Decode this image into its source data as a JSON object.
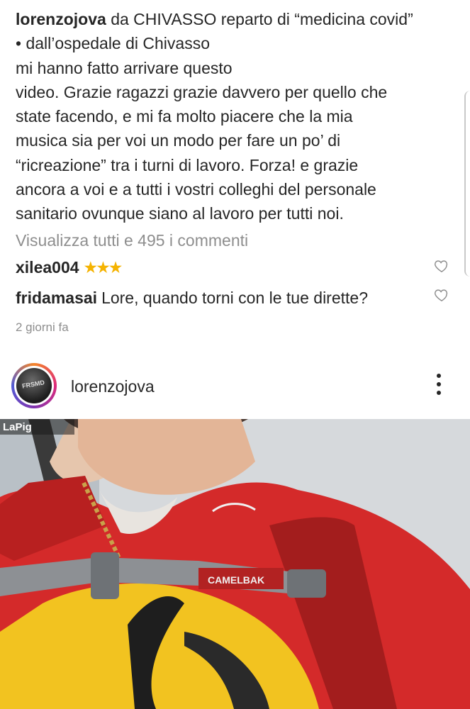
{
  "caption": {
    "username": "lorenzojova",
    "text": " da CHIVASSO reparto di “medicina covid”\n• dall’ospedale di Chivasso\nmi hanno fatto arrivare questo\nvideo. Grazie ragazzi grazie davvero per quello che\nstate facendo, e mi fa molto piacere che la mia\nmusica sia per voi un modo per fare un po’ di\n“ricreazione” tra i turni di lavoro. Forza! e grazie\nancora a voi e a tutti i vostri colleghi del personale\nsanitario ovunque siano al lavoro per tutti noi."
  },
  "view_all_comments": "Visualizza tutti e 495 i commenti",
  "comments": [
    {
      "username": "xilea004",
      "text": "★★★"
    },
    {
      "username": "fridamasai",
      "text": "Lore, quando torni con le tue dirette?"
    }
  ],
  "timestamp": "2 giorni fa",
  "post": {
    "username": "lorenzojova",
    "avatar_text": "FRSMD",
    "watermark": "LaPig",
    "backpack_brand": "CAMELBAK"
  },
  "icons": {
    "like": "heart-outline-icon",
    "menu": "more-vertical-icon"
  },
  "colors": {
    "text": "#262626",
    "muted": "#8e8e8e",
    "star": "#f5b301",
    "jacket": "#d42a2a"
  }
}
